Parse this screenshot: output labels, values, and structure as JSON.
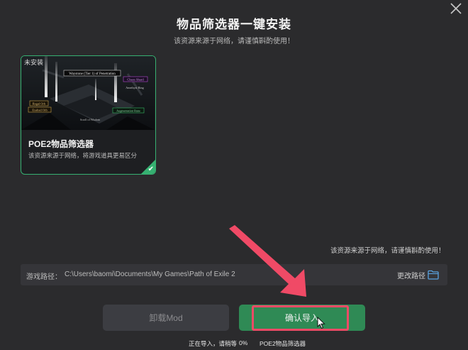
{
  "dialog": {
    "title": "物品筛选器一键安装",
    "subtitle": "该资源来源于网络，请谨慎斟酌使用！"
  },
  "card": {
    "badge": "未安装",
    "title": "POE2物品筛选器",
    "description": "该资源来源于网络，将游戏道具更易区分",
    "image_labels": [
      "Waystone (Tier 1) of Penetration",
      "Chaos Shard",
      "Amethyst Ring",
      "Regal Orb",
      "Exalted Orb",
      "Scroll of Wisdom",
      "Augmentation Rune"
    ]
  },
  "notice": "该资源来源于网络，请谨慎斟酌使用！",
  "path": {
    "label": "游戏路径：",
    "value": "C:\\Users\\baomi\\Documents\\My Games\\Path of Exile 2",
    "change_label": "更改路径"
  },
  "buttons": {
    "uninstall": "卸载Mod",
    "confirm": "确认导入"
  },
  "status": {
    "importing": "正在导入，请稍等",
    "percent": "0%",
    "item": "POE2物品筛选器"
  },
  "colors": {
    "accent": "#36b071",
    "confirm": "#2f8a55",
    "highlight": "#f04a66"
  }
}
